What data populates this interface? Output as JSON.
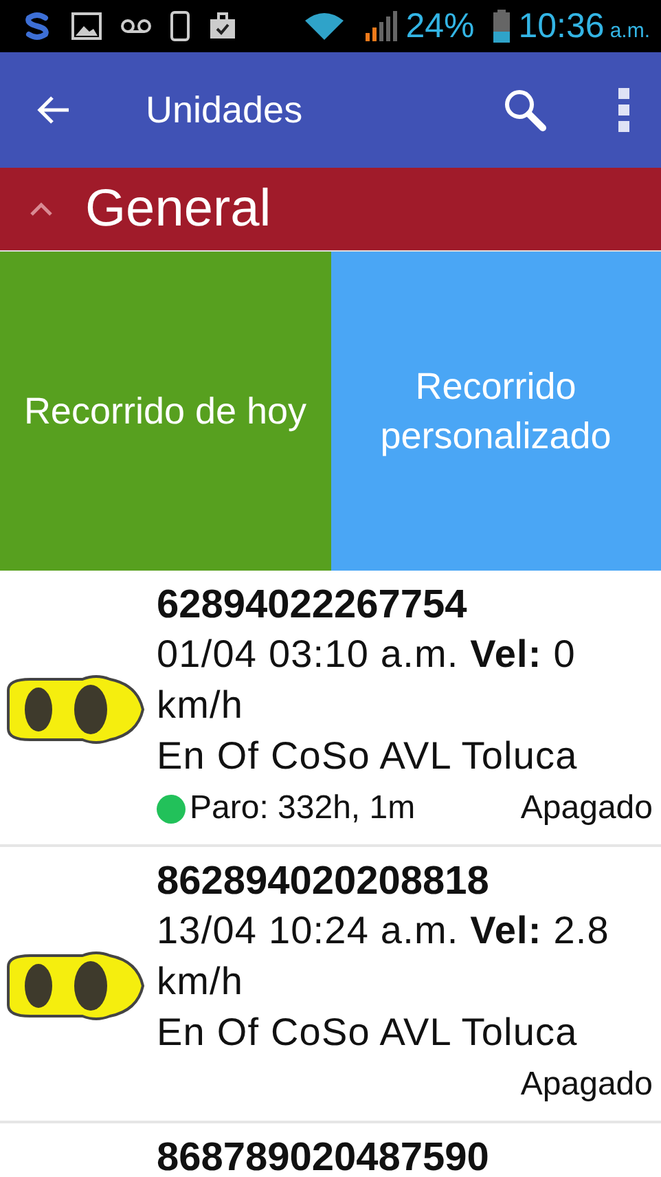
{
  "status_bar": {
    "battery": "24%",
    "time": "10:36",
    "meridiem": "a.m."
  },
  "app_bar": {
    "title": "Unidades"
  },
  "section": {
    "title": "General",
    "expanded": true
  },
  "tiles": [
    {
      "label": "Recorrido de hoy",
      "color": "#57a01f"
    },
    {
      "label": "Recorrido personalizado",
      "color": "#4aa6f5"
    }
  ],
  "units": [
    {
      "id": "62894022267754",
      "detail": "01/04 03:10 a.m. **Vel:** 0 km/h",
      "place": "En Of CoSo AVL Toluca",
      "stop": "Paro: 332h, 1m",
      "color": "#22c15a",
      "state": "Apagado"
    },
    {
      "id": "862894020208818",
      "detail": "13/04 10:24 a.m. **Vel:** 2.8 km/h",
      "place": "En Of CoSo AVL Toluca",
      "state": "Apagado"
    },
    {
      "id": "868789020487590"
    }
  ]
}
